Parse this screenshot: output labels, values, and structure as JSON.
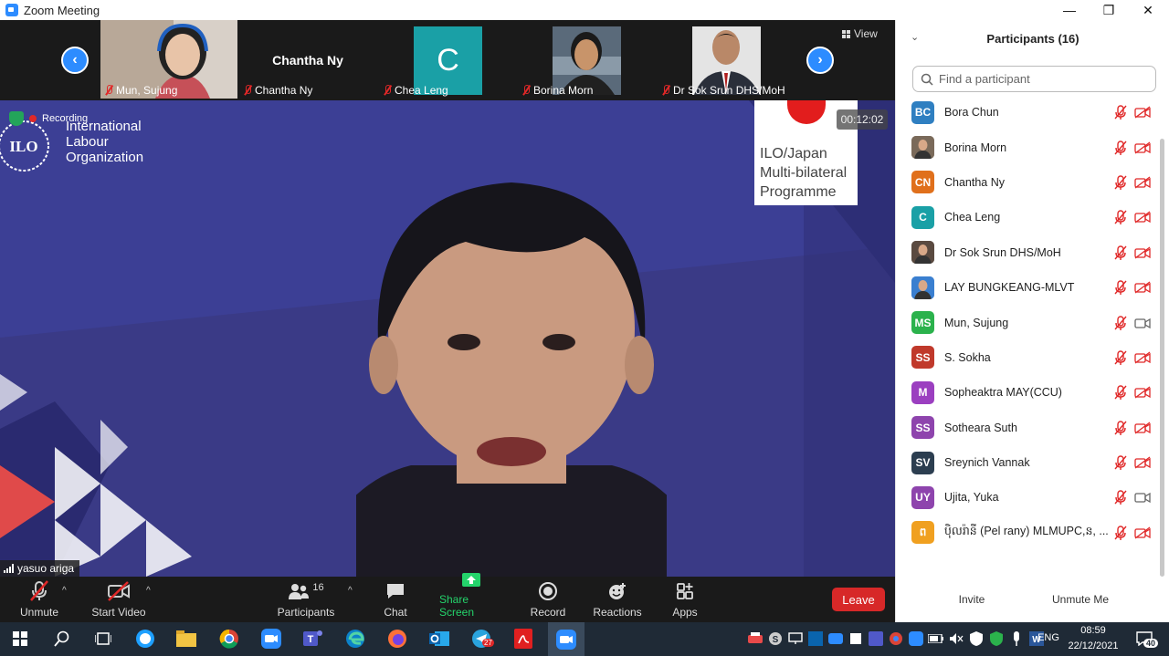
{
  "window": {
    "title": "Zoom Meeting"
  },
  "strip": {
    "view_label": "View",
    "participants": [
      {
        "name": "Mun, Sujung",
        "type": "video-woman"
      },
      {
        "name": "Chantha Ny",
        "display": "Chantha Ny",
        "type": "name-only"
      },
      {
        "name": "Chea Leng",
        "type": "letter",
        "letter": "C",
        "color": "#1aa0a6"
      },
      {
        "name": "Borina Morn",
        "type": "video-woman2"
      },
      {
        "name": "Dr Sok Srun DHS/MoH",
        "type": "video-man"
      }
    ]
  },
  "stage": {
    "recording_label": "Recording",
    "timer": "00:12:02",
    "speaker": "yasuo ariga",
    "logo_lines": [
      "International",
      "Labour",
      "Organization"
    ],
    "logo_mark": "ILO",
    "card_lines": [
      "ILO/Japan",
      "Multi-bilateral",
      "Programme"
    ]
  },
  "toolbar": {
    "unmute": "Unmute",
    "start_video": "Start Video",
    "participants": "Participants",
    "participants_count": "16",
    "chat": "Chat",
    "share_screen": "Share Screen",
    "record": "Record",
    "reactions": "Reactions",
    "apps": "Apps",
    "leave": "Leave"
  },
  "panel": {
    "title": "Participants (16)",
    "search_placeholder": "Find a participant",
    "invite": "Invite",
    "unmute_me": "Unmute Me",
    "participants": [
      {
        "initials": "BC",
        "name": "Bora Chun",
        "color": "#2f7fc1",
        "video": false
      },
      {
        "initials": "",
        "name": "Borina Morn",
        "color": "#7a6a5a",
        "photo": true,
        "video": false
      },
      {
        "initials": "CN",
        "name": "Chantha Ny",
        "color": "#e0701c",
        "video": false
      },
      {
        "initials": "C",
        "name": "Chea Leng",
        "color": "#1aa0a6",
        "video": false
      },
      {
        "initials": "",
        "name": "Dr Sok Srun DHS/MoH",
        "color": "#5a4a40",
        "photo": true,
        "video": false
      },
      {
        "initials": "",
        "name": "LAY BUNGKEANG-MLVT",
        "color": "#3a7fd0",
        "photo": true,
        "video": false
      },
      {
        "initials": "MS",
        "name": "Mun, Sujung",
        "color": "#2bb24c",
        "video": true
      },
      {
        "initials": "SS",
        "name": "S. Sokha",
        "color": "#c0392b",
        "video": false
      },
      {
        "initials": "M",
        "name": "Sopheaktra MAY(CCU)",
        "color": "#9b3fc0",
        "video": false
      },
      {
        "initials": "SS",
        "name": "Sotheara Suth",
        "color": "#8e44ad",
        "video": false
      },
      {
        "initials": "SV",
        "name": "Sreynich Vannak",
        "color": "#2c3e50",
        "video": false
      },
      {
        "initials": "UY",
        "name": "Ujita, Yuka",
        "color": "#8e44ad",
        "video": true
      },
      {
        "initials": "ព",
        "name": "ប៉ិលរ៉ានី (Pel rany) MLMUPC,ន, ...",
        "color": "#f0a020",
        "video": false
      }
    ]
  },
  "taskbar": {
    "time": "08:59",
    "date": "22/12/2021",
    "lang": "ENG",
    "notif_count": "40",
    "teams_badge": "27"
  }
}
